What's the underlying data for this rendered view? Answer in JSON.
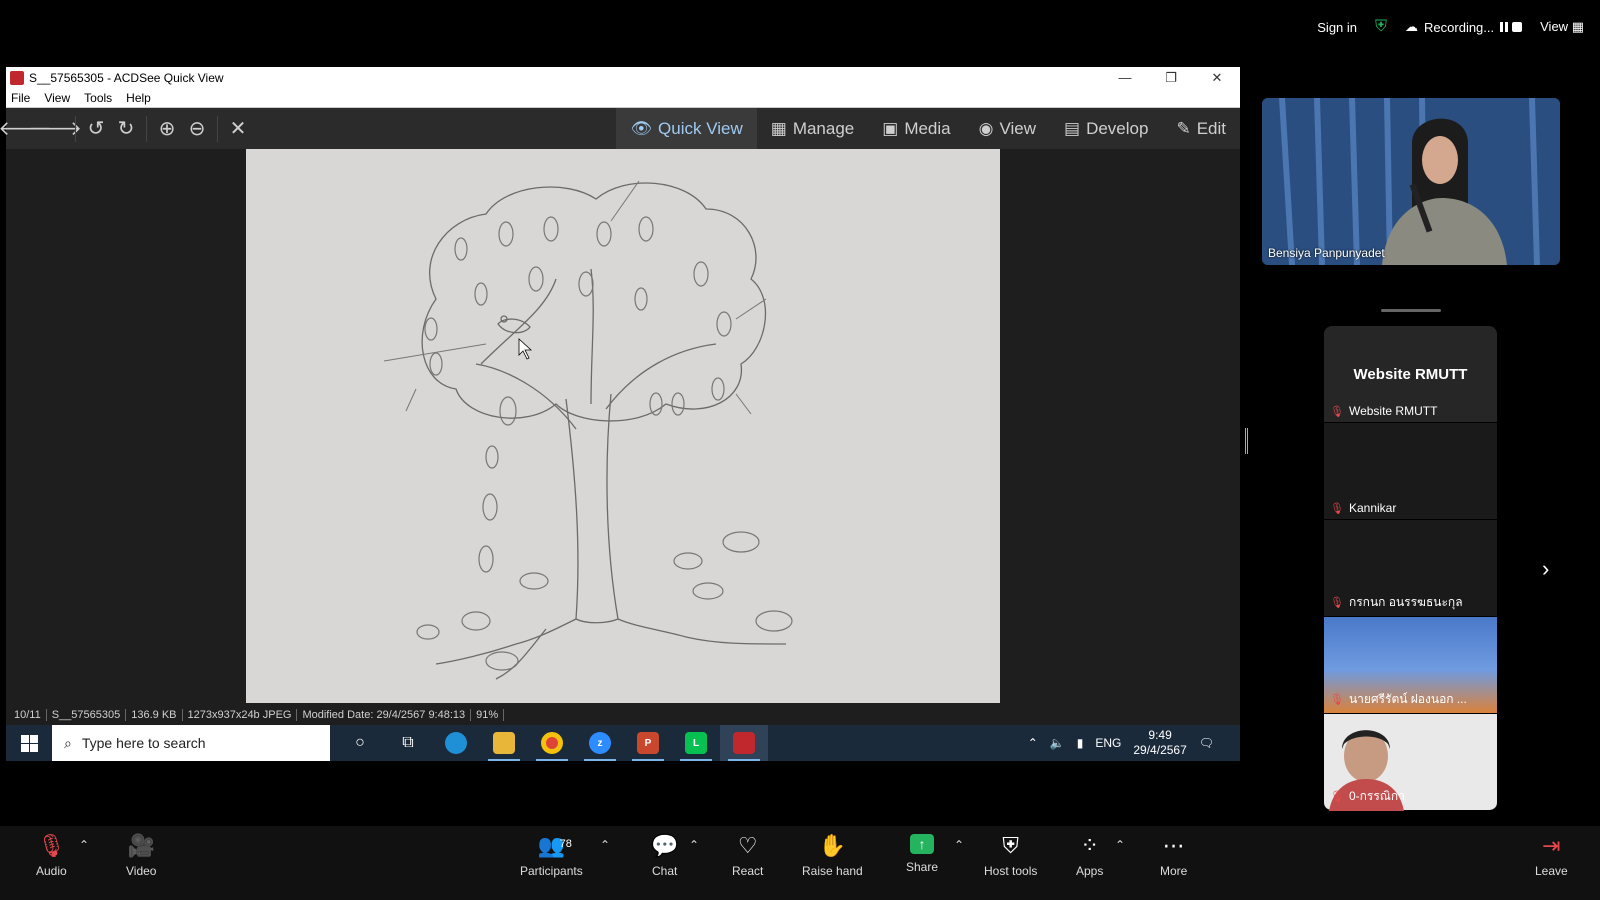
{
  "zoom_top": {
    "sign_in": "Sign in",
    "recording": "Recording...",
    "view": "View"
  },
  "acdsee": {
    "title": "S__57565305 - ACDSee Quick View",
    "menu": [
      "File",
      "View",
      "Tools",
      "Help"
    ],
    "modes": [
      {
        "label": "Quick View",
        "icon": "eye-icon"
      },
      {
        "label": "Manage",
        "icon": "grid-icon"
      },
      {
        "label": "Media",
        "icon": "media-icon"
      },
      {
        "label": "View",
        "icon": "eye-icon"
      },
      {
        "label": "Develop",
        "icon": "develop-icon"
      },
      {
        "label": "Edit",
        "icon": "edit-icon"
      }
    ],
    "status": {
      "index": "10/11",
      "filename": "S__57565305",
      "size": "136.9 KB",
      "dims": "1273x937x24b JPEG",
      "modified": "Modified Date: 29/4/2567 9:48:13",
      "zoom": "91%"
    }
  },
  "taskbar": {
    "search_placeholder": "Type here to search",
    "lang": "ENG",
    "time": "9:49",
    "date": "29/4/2567"
  },
  "gallery": {
    "speaker_name": "Bensiya Panpunyadet",
    "tiles": [
      {
        "big": "Website RMUTT",
        "label": "Website RMUTT"
      },
      {
        "label": "Kannikar"
      },
      {
        "label": "กรกนก อนรรฆธนะกุล"
      },
      {
        "label": "นายศรีรัตน์ ฝองนอก ..."
      },
      {
        "label": "0-กรรณิกา"
      }
    ]
  },
  "zoom_bottom": {
    "audio": "Audio",
    "video": "Video",
    "participants": "Participants",
    "participants_count": "78",
    "chat": "Chat",
    "react": "React",
    "raise_hand": "Raise hand",
    "share": "Share",
    "host_tools": "Host tools",
    "apps": "Apps",
    "more": "More",
    "leave": "Leave"
  }
}
